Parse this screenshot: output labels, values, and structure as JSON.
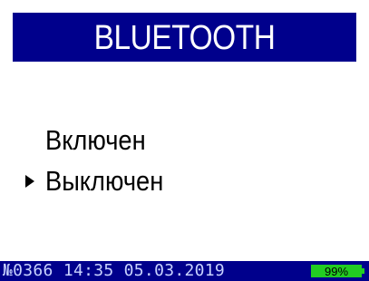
{
  "header": {
    "title": "BLUETOOTH"
  },
  "menu": {
    "items": [
      {
        "label": "Включен",
        "selected": false
      },
      {
        "label": "Выключен",
        "selected": true
      }
    ]
  },
  "status_bar": {
    "device_number": "№0366",
    "time": "14:35",
    "date": "05.03.2019",
    "battery": "99%"
  },
  "colors": {
    "header_bg": "#00008c",
    "status_bg": "#00008c",
    "battery_fill": "#22cc22",
    "text": "#000000"
  }
}
